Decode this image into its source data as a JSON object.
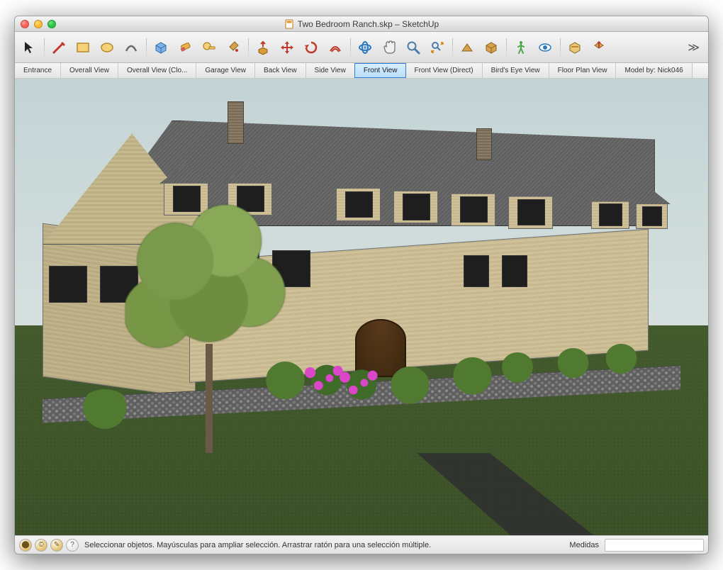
{
  "window": {
    "title": "Two Bedroom Ranch.skp – SketchUp"
  },
  "toolbar": {
    "select": "Select",
    "line": "Line",
    "rectangle": "Rectangle",
    "circle": "Circle",
    "arc": "Arc",
    "make_component": "Make Component",
    "eraser": "Eraser",
    "tape_measure": "Tape Measure",
    "paint_bucket": "Paint Bucket",
    "push_pull": "Push/Pull",
    "move": "Move",
    "rotate": "Rotate",
    "offset": "Offset",
    "orbit": "Orbit",
    "pan": "Pan",
    "zoom": "Zoom",
    "zoom_extents": "Zoom Extents",
    "add_location": "Add Location",
    "get_models": "Get Models",
    "walk": "Walk",
    "look_around": "Look Around",
    "section_plane": "Section Plane",
    "get_photo_texture": "Get Photo Texture"
  },
  "scene_tabs": {
    "items": [
      {
        "label": "Entrance",
        "active": false
      },
      {
        "label": "Overall View",
        "active": false
      },
      {
        "label": "Overall View (Clo...",
        "active": false
      },
      {
        "label": "Garage View",
        "active": false
      },
      {
        "label": "Back View",
        "active": false
      },
      {
        "label": "Side View",
        "active": false
      },
      {
        "label": "Front View",
        "active": true
      },
      {
        "label": "Front View (Direct)",
        "active": false
      },
      {
        "label": "Bird's Eye View",
        "active": false
      },
      {
        "label": "Floor Plan View",
        "active": false
      },
      {
        "label": "Model by: Nick046",
        "active": false
      }
    ]
  },
  "statusbar": {
    "hint": "Seleccionar objetos. Mayúsculas para ampliar selección. Arrastrar ratón para una selección múltiple.",
    "measure_label": "Medidas",
    "measure_value": ""
  }
}
